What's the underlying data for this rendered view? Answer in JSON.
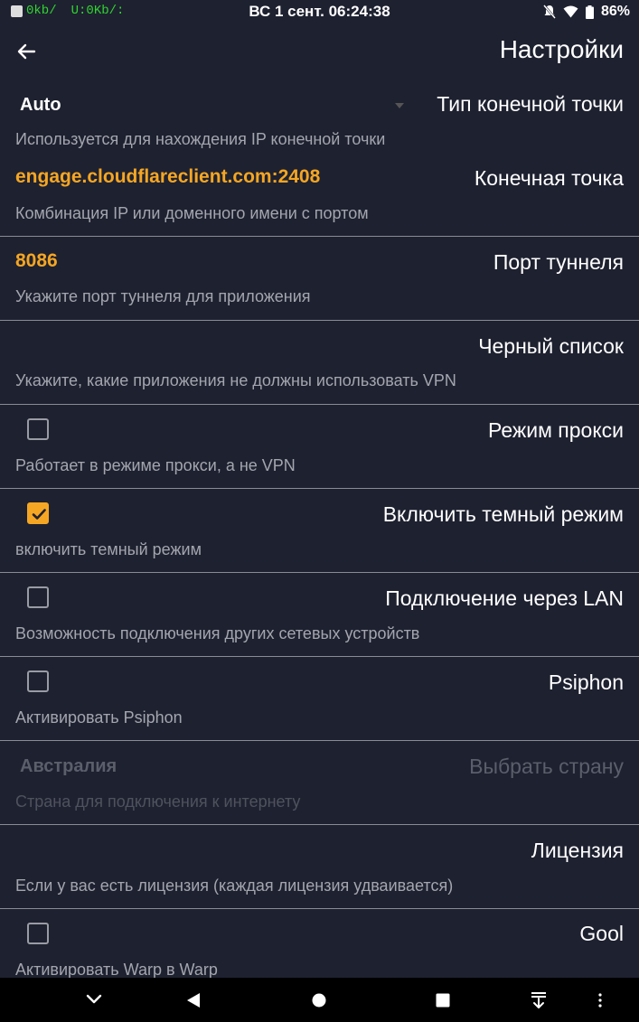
{
  "status_bar": {
    "net_down": "0kb/",
    "net_up": "U:0Kb/:",
    "datetime": "ВС 1 сент. 06:24:38",
    "battery": "86%"
  },
  "header": {
    "title": "Настройки"
  },
  "settings": {
    "endpoint_type": {
      "label": "Тип конечной точки",
      "value": "Auto",
      "description": "Используется для нахождения IP конечной точки"
    },
    "endpoint": {
      "label": "Конечная точка",
      "value": "engage.cloudflareclient.com:2408",
      "description": "Комбинация IP или доменного имени с портом"
    },
    "tunnel_port": {
      "label": "Порт туннеля",
      "value": "8086",
      "description": "Укажите порт туннеля для приложения"
    },
    "blacklist": {
      "label": "Черный список",
      "description": "Укажите, какие приложения не должны использовать VPN"
    },
    "proxy_mode": {
      "label": "Режим прокси",
      "description": "Работает в режиме прокси, а не VPN",
      "checked": false
    },
    "dark_mode": {
      "label": "Включить темный режим",
      "description": "включить темный режим",
      "checked": true
    },
    "lan": {
      "label": "Подключение через LAN",
      "description": "Возможность подключения других сетевых устройств",
      "checked": false
    },
    "psiphon": {
      "label": "Psiphon",
      "description": "Активировать Psiphon",
      "checked": false
    },
    "country": {
      "label": "Выбрать страну",
      "value": "Австралия",
      "description": "Страна для подключения к интернету",
      "enabled": false
    },
    "license": {
      "label": "Лицензия",
      "description": "Если у вас есть лицензия (каждая лицензия удваивается)"
    },
    "gool": {
      "label": "Gool",
      "description": "Активировать Warp в Warp",
      "checked": false
    }
  },
  "colors": {
    "background": "#1e2130",
    "accent": "#f5a623",
    "divider": "#8a8c94"
  }
}
